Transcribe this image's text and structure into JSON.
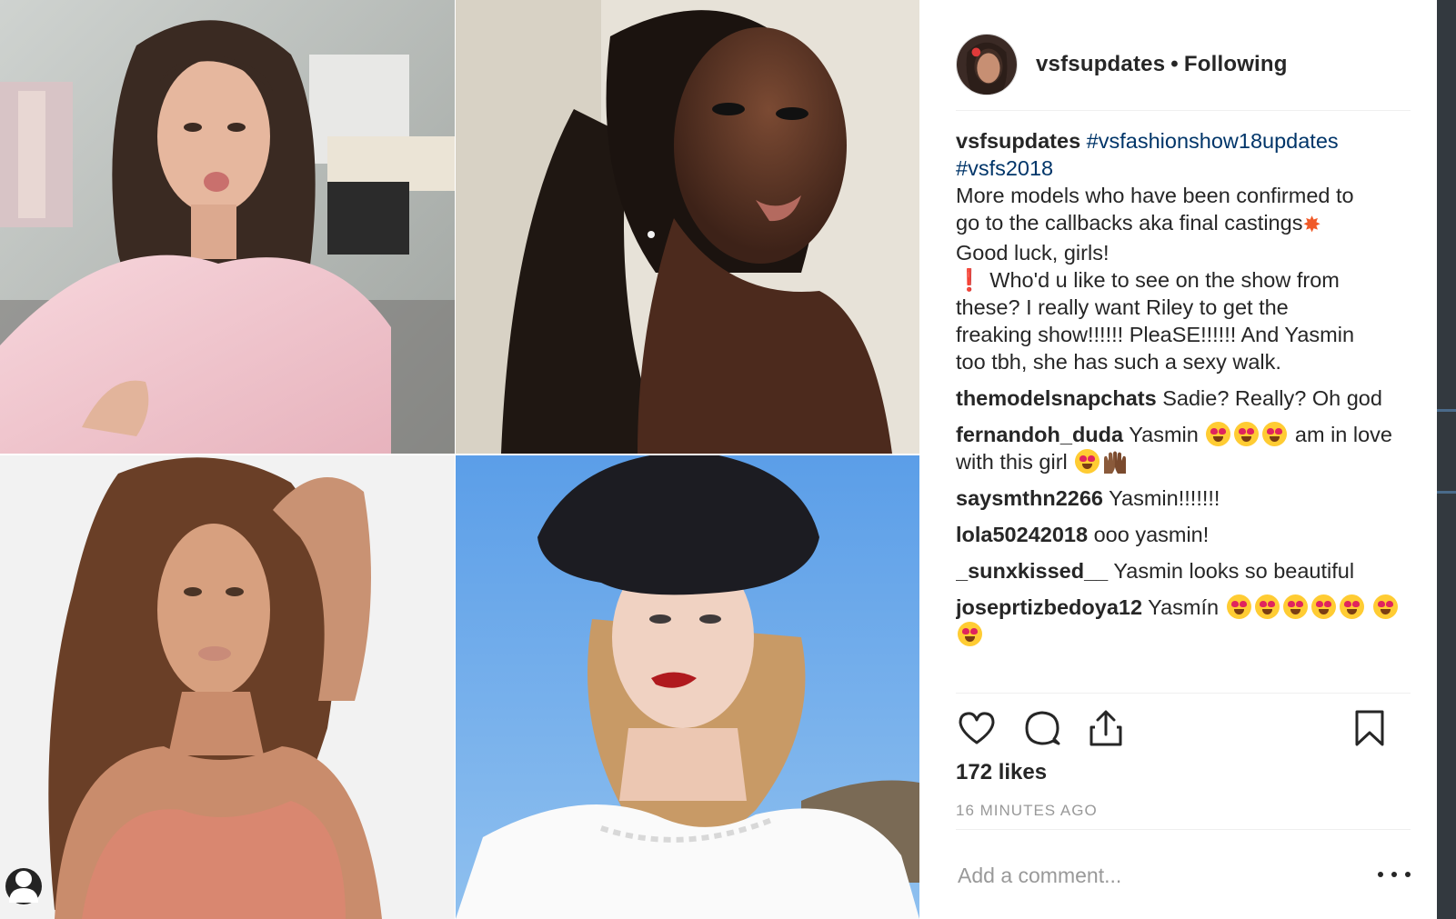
{
  "post": {
    "username": "vsfsupdates",
    "separator": "•",
    "follow_status": "Following",
    "photo_alts": [
      "Model in pink satin robe",
      "Model with high ponytail",
      "Model in coral lace top",
      "Model in black beret"
    ]
  },
  "caption": {
    "username": "vsfsupdates",
    "hashtag1": "#vsfashionshow18updates",
    "hashtag2": "#vsfs2018",
    "line1": "More models who have been confirmed to",
    "line2": "go to the callbacks aka final castings",
    "line3": "Good luck, girls!",
    "line4": "Who'd u like to see on the show from",
    "line5": "these? I really want Riley to get the",
    "line6": "freaking show!!!!!! PleaSE!!!!!! And Yasmin",
    "line7": "too tbh, she has such a sexy walk."
  },
  "comments": [
    {
      "user": "themodelsnapchats",
      "text": "Sadie? Really? Oh god"
    },
    {
      "user": "fernandoh_duda",
      "text": "Yasmin",
      "text_after": "am in love with this girl"
    },
    {
      "user": "saysmthn2266",
      "text": "Yasmin!!!!!!!"
    },
    {
      "user": "lola50242018",
      "text": "ooo yasmin!"
    },
    {
      "user": "_sunxkissed__",
      "text": "Yasmin looks so beautiful"
    },
    {
      "user": "joseprtizbedoya12",
      "text": "Yasmín"
    }
  ],
  "actions": {
    "like_icon": "heart-icon",
    "comment_icon": "comment-bubble-icon",
    "share_icon": "share-icon",
    "save_icon": "bookmark-icon"
  },
  "likes": "172 likes",
  "timestamp": "16 MINUTES AGO",
  "add_comment": {
    "placeholder": "Add a comment..."
  },
  "colors": {
    "text": "#262626",
    "link": "#003569",
    "muted": "#999999",
    "divider": "#efefef"
  }
}
